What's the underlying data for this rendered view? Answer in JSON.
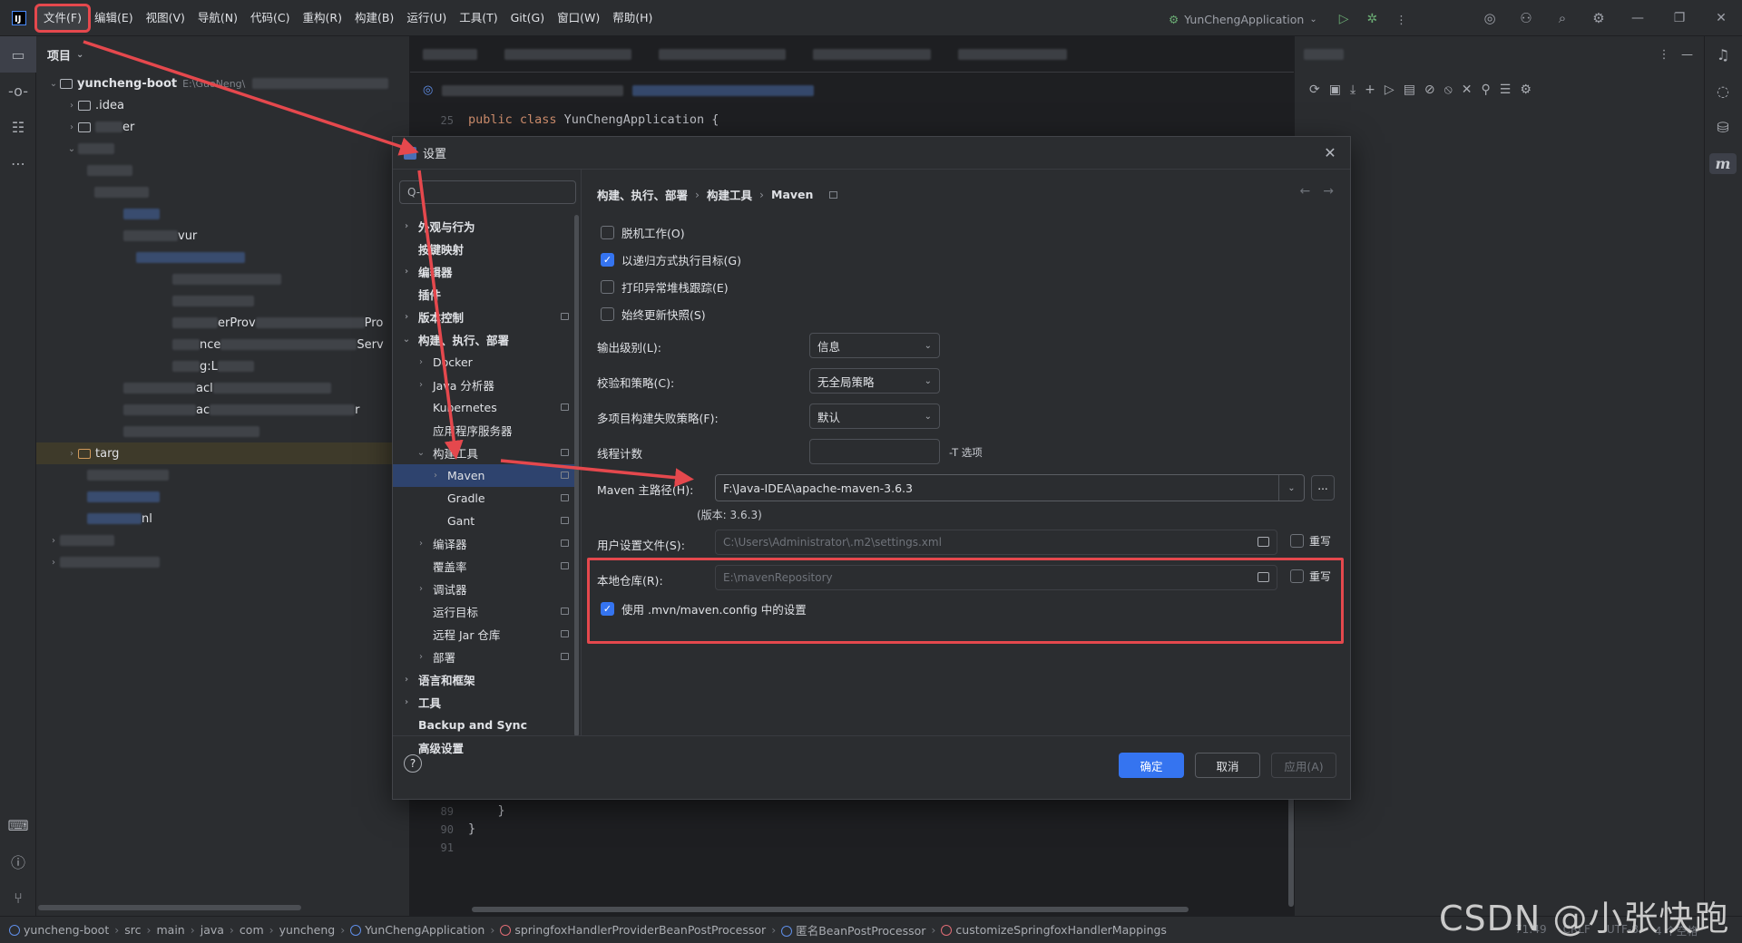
{
  "menubar": {
    "items": [
      "文件(F)",
      "编辑(E)",
      "视图(V)",
      "导航(N)",
      "代码(C)",
      "重构(R)",
      "构建(B)",
      "运行(U)",
      "工具(T)",
      "Git(G)",
      "窗口(W)",
      "帮助(H)"
    ],
    "active_index": 0
  },
  "titlebar": {
    "run_config": "YunChengApplication"
  },
  "project": {
    "header": "项目",
    "root_name": "yuncheng-boot",
    "root_path": "E:\\GuoNeng\\",
    "items": [
      ".idea",
      "er",
      "vur",
      "erProv",
      "Pro",
      "nce",
      "Serv",
      "g:L",
      "acl",
      "ac",
      "r",
      "targ",
      "nl"
    ]
  },
  "editor": {
    "code": {
      "line_no_25": "25",
      "class_line_kw": "public class",
      "class_line_name": " YunChengApplication {",
      "ln89": "89",
      "ln90": "90",
      "ln91": "91",
      "close1": "    }",
      "close2": "}"
    }
  },
  "dialog": {
    "title": "设置",
    "search_placeholder": "Q-",
    "tree": [
      {
        "label": "外观与行为",
        "indent": 0,
        "chev": "›",
        "bold": true
      },
      {
        "label": "按键映射",
        "indent": 0,
        "chev": "",
        "bold": true
      },
      {
        "label": "编辑器",
        "indent": 0,
        "chev": "›",
        "bold": true
      },
      {
        "label": "插件",
        "indent": 0,
        "chev": "",
        "bold": true
      },
      {
        "label": "版本控制",
        "indent": 0,
        "chev": "›",
        "bold": true,
        "page": true
      },
      {
        "label": "构建、执行、部署",
        "indent": 0,
        "chev": "⌄",
        "bold": true
      },
      {
        "label": "Docker",
        "indent": 1,
        "chev": "›"
      },
      {
        "label": "Java 分析器",
        "indent": 1,
        "chev": "›"
      },
      {
        "label": "Kubernetes",
        "indent": 1,
        "chev": "",
        "page": true
      },
      {
        "label": "应用程序服务器",
        "indent": 1,
        "chev": ""
      },
      {
        "label": "构建工具",
        "indent": 1,
        "chev": "⌄",
        "page": true
      },
      {
        "label": "Maven",
        "indent": 2,
        "chev": "›",
        "page": true,
        "selected": true
      },
      {
        "label": "Gradle",
        "indent": 2,
        "chev": "",
        "page": true
      },
      {
        "label": "Gant",
        "indent": 2,
        "chev": "",
        "page": true
      },
      {
        "label": "编译器",
        "indent": 1,
        "chev": "›",
        "page": true
      },
      {
        "label": "覆盖率",
        "indent": 1,
        "chev": "",
        "page": true
      },
      {
        "label": "调试器",
        "indent": 1,
        "chev": "›"
      },
      {
        "label": "运行目标",
        "indent": 1,
        "chev": "",
        "page": true
      },
      {
        "label": "远程 Jar 仓库",
        "indent": 1,
        "chev": "",
        "page": true
      },
      {
        "label": "部署",
        "indent": 1,
        "chev": "›",
        "page": true
      },
      {
        "label": "语言和框架",
        "indent": 0,
        "chev": "›",
        "bold": true
      },
      {
        "label": "工具",
        "indent": 0,
        "chev": "›",
        "bold": true
      },
      {
        "label": "Backup and Sync",
        "indent": 0,
        "chev": "",
        "bold": true
      },
      {
        "label": "高级设置",
        "indent": 0,
        "chev": "",
        "bold": true
      }
    ],
    "breadcrumb": [
      "构建、执行、部署",
      "构建工具",
      "Maven"
    ],
    "checkboxes": [
      {
        "label": "脱机工作(O)",
        "checked": false
      },
      {
        "label": "以递归方式执行目标(G)",
        "checked": true
      },
      {
        "label": "打印异常堆栈跟踪(E)",
        "checked": false
      },
      {
        "label": "始终更新快照(S)",
        "checked": false
      }
    ],
    "fields": {
      "output_level_label": "输出级别(L):",
      "output_level_value": "信息",
      "checksum_label": "校验和策略(C):",
      "checksum_value": "无全局策略",
      "failure_label": "多项目构建失败策略(F):",
      "failure_value": "默认",
      "threads_label": "线程计数",
      "threads_hint": "-T 选项",
      "maven_home_label": "Maven 主路径(H):",
      "maven_home_value": "F:\\Java-IDEA\\apache-maven-3.6.3",
      "maven_home_more": "...",
      "version": "(版本: 3.6.3)",
      "user_settings_label": "用户设置文件(S):",
      "user_settings_value": "C:\\Users\\Administrator\\.m2\\settings.xml",
      "local_repo_label": "本地仓库(R):",
      "local_repo_value": "E:\\mavenRepository",
      "override_label": "重写",
      "use_mvn_config": "使用 .mvn/maven.config 中的设置"
    },
    "buttons": {
      "ok": "确定",
      "cancel": "取消",
      "apply": "应用(A)",
      "help": "?"
    }
  },
  "statusbar": {
    "crumbs": [
      "yuncheng-boot",
      "src",
      "main",
      "java",
      "com",
      "yuncheng",
      "YunChengApplication",
      "springfoxHandlerProviderBeanPostProcessor",
      "匿名BeanPostProcessor",
      "customizeSpringfoxHandlerMappings"
    ],
    "right": [
      "71:49",
      "CRLF",
      "UTF-8",
      "4 个空格"
    ],
    "watermark": "CSDN @小张快跑"
  },
  "colors": {
    "accent": "#3574f0",
    "annotation": "#e5484d",
    "background": "#1e1f22",
    "panel": "#2b2d30"
  }
}
